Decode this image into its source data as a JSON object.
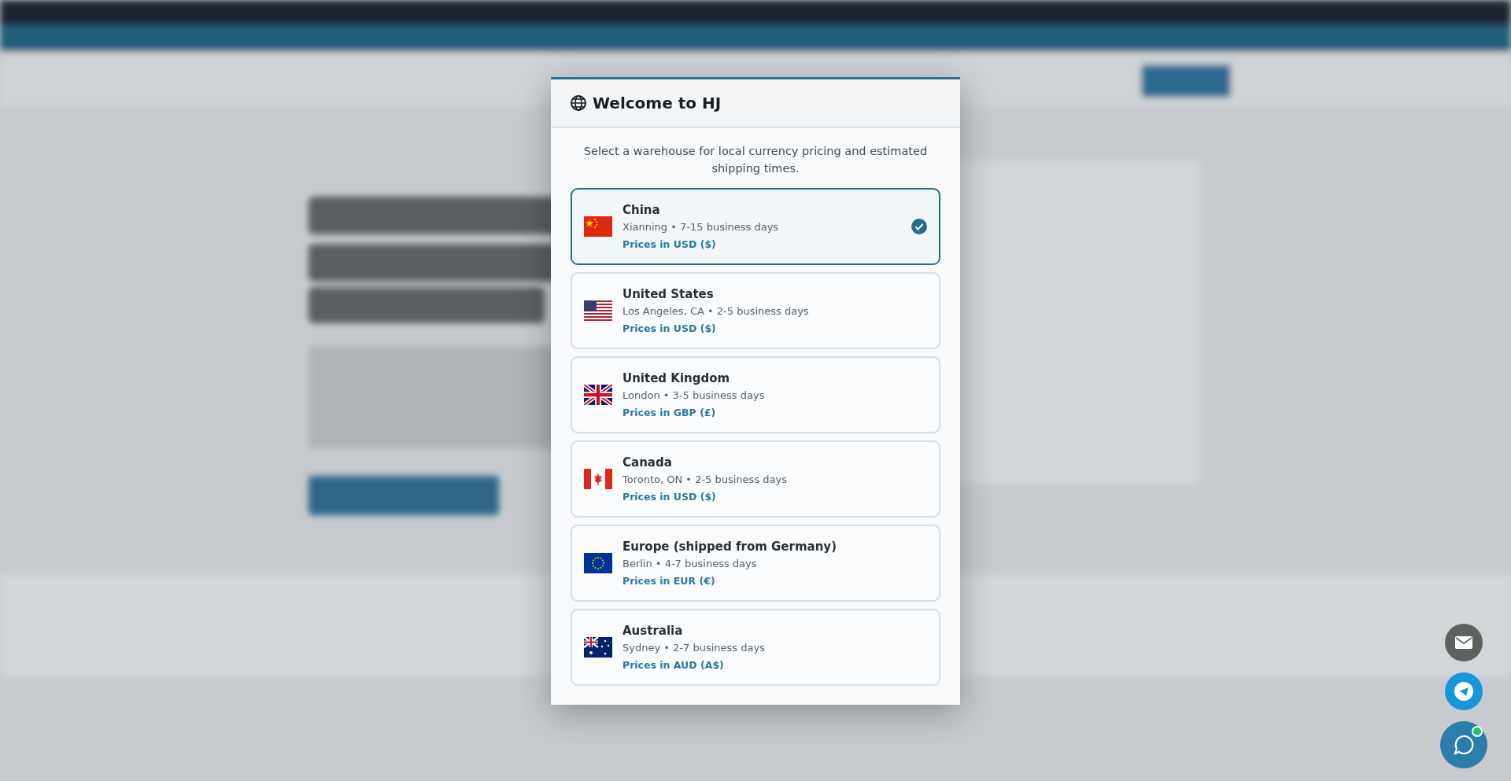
{
  "dialog": {
    "title": "Welcome to HJ",
    "intro": "Select a warehouse for local currency pricing and estimated shipping times.",
    "warehouses": [
      {
        "kind": "cn",
        "name": "China",
        "detail": "Xianning • 7-15 business days",
        "currency": "Prices in USD ($)",
        "selected": true
      },
      {
        "kind": "us",
        "name": "United States",
        "detail": "Los Angeles, CA • 2-5 business days",
        "currency": "Prices in USD ($)",
        "selected": false
      },
      {
        "kind": "gb",
        "name": "United Kingdom",
        "detail": "London • 3-5 business days",
        "currency": "Prices in GBP (£)",
        "selected": false
      },
      {
        "kind": "ca",
        "name": "Canada",
        "detail": "Toronto, ON • 2-5 business days",
        "currency": "Prices in USD ($)",
        "selected": false
      },
      {
        "kind": "eu",
        "name": "Europe (shipped from Germany)",
        "detail": "Berlin • 4-7 business days",
        "currency": "Prices in EUR (€)",
        "selected": false
      },
      {
        "kind": "au",
        "name": "Australia",
        "detail": "Sydney • 2-7 business days",
        "currency": "Prices in AUD (A$)",
        "selected": false
      }
    ]
  },
  "contact_buttons": [
    {
      "kind": "email"
    },
    {
      "kind": "telegram"
    },
    {
      "kind": "chat",
      "online": true
    }
  ]
}
